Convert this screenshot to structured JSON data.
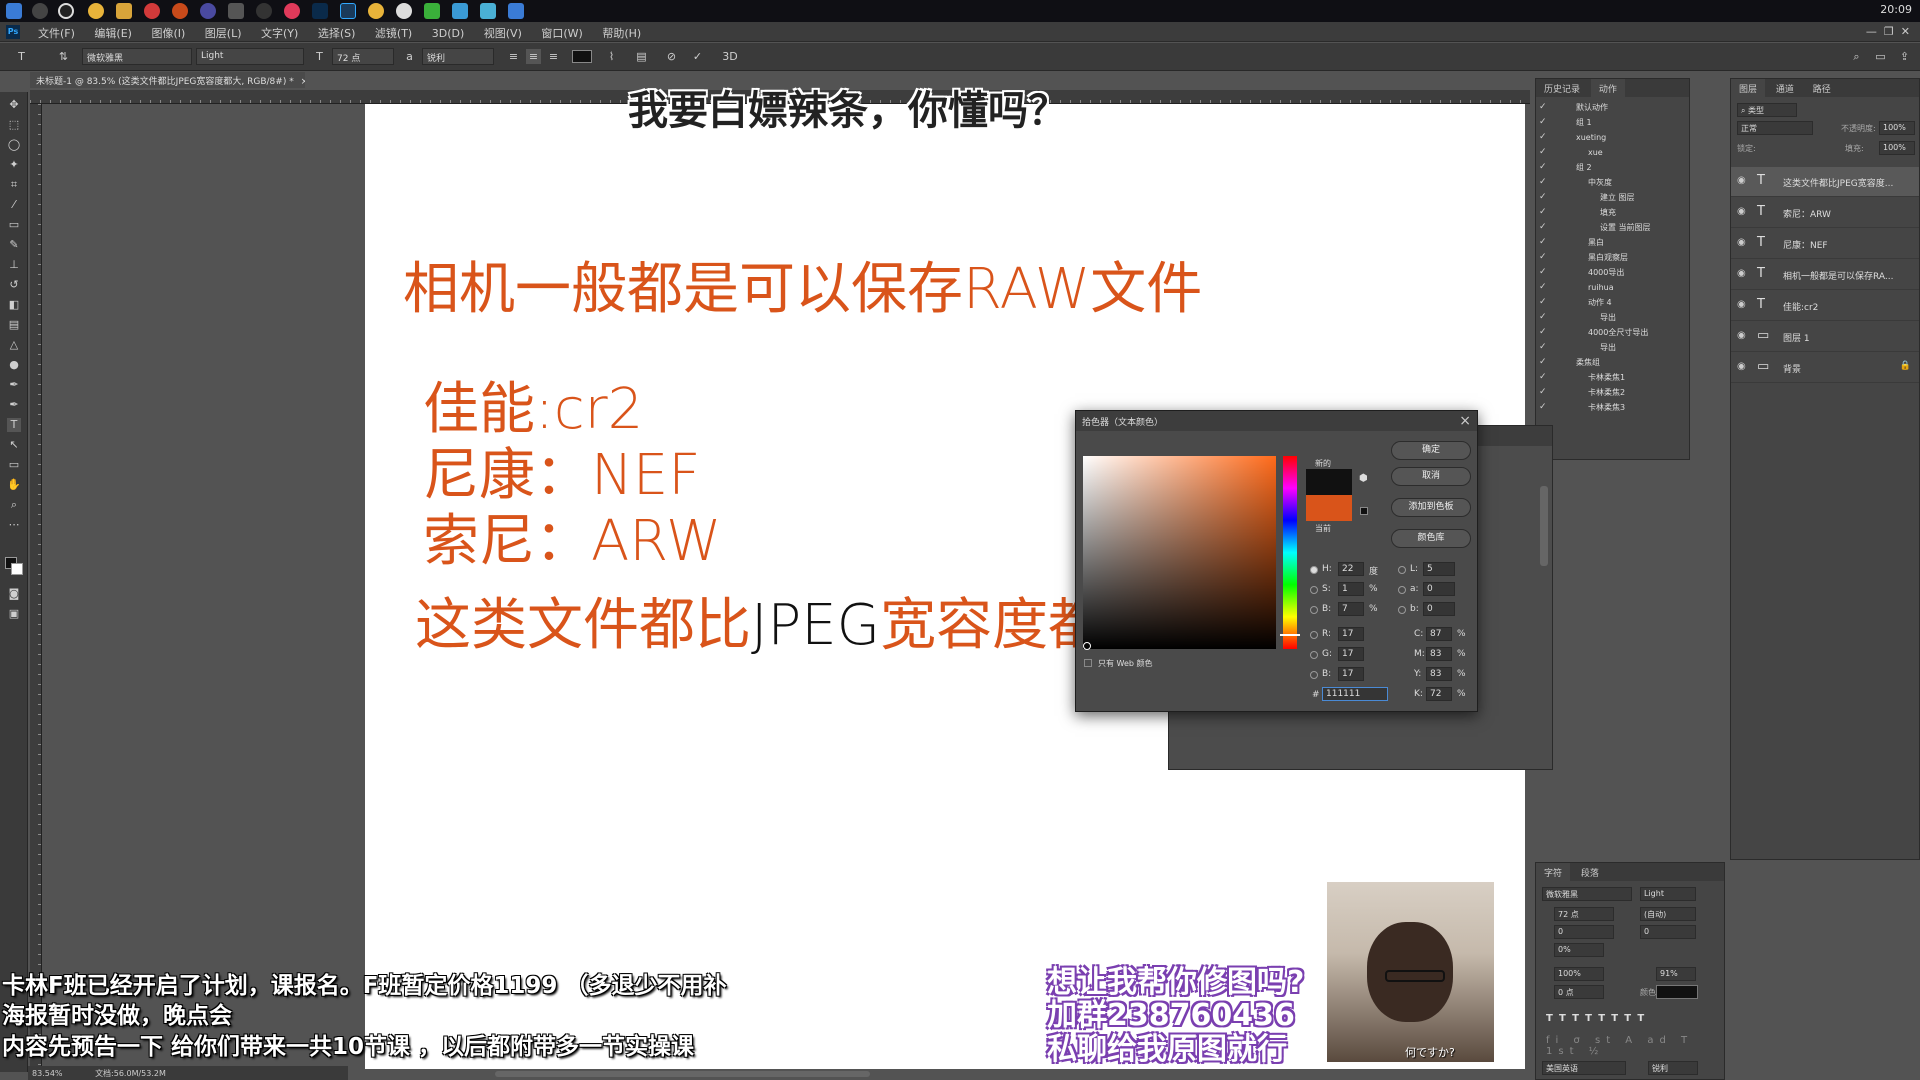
{
  "taskbar": {
    "clock": "20:09"
  },
  "menubar": {
    "items": [
      "文件(F)",
      "编辑(E)",
      "图像(I)",
      "图层(L)",
      "文字(Y)",
      "选择(S)",
      "滤镜(T)",
      "3D(D)",
      "视图(V)",
      "窗口(W)",
      "帮助(H)"
    ]
  },
  "options": {
    "font_family": "微软雅黑",
    "font_style": "Light",
    "font_size": "72 点",
    "antialias": "锐利",
    "threeD": "3D"
  },
  "document": {
    "tab_title": "未标题-1 @ 83.5% (这类文件都比JPEG宽容度都大, RGB/8#) *",
    "zoom": "83.54%",
    "doc_size": "文档:56.0M/53.2M"
  },
  "canvas": {
    "line1": "相机一般都是可以保存RAW文件",
    "canon": "佳能:cr2",
    "nikon": "尼康：NEF",
    "sony": "索尼：ARW",
    "line5_a": "这类文件都比",
    "line5_b": "JPEG",
    "line5_c": "宽容度都"
  },
  "color_picker": {
    "title": "拾色器（文本颜色）",
    "new_label": "新的",
    "current_label": "当前",
    "new_color": "#111111",
    "current_color": "#d9541a",
    "ok": "确定",
    "cancel": "取消",
    "add_swatch": "添加到色板",
    "color_library": "颜色库",
    "web_only": "只有 Web 颜色",
    "H": "22",
    "H_unit": "度",
    "S": "1",
    "S_unit": "%",
    "B": "7",
    "B_unit": "%",
    "R": "17",
    "G": "17",
    "Bv": "17",
    "L": "5",
    "a": "0",
    "b": "0",
    "C": "87",
    "M": "83",
    "Y": "83",
    "K": "72",
    "hex": "111111",
    "pct": "%"
  },
  "history_panel": {
    "tabs": [
      "历史记录",
      "动作"
    ],
    "rows": [
      "默认动作",
      "组 1",
      "xueting",
      "xue",
      "组 2",
      "中灰度",
      "建立 图层",
      "填充",
      "设置 当前图层",
      "黑白",
      "黑白观察层",
      "4000导出",
      "ruihua",
      "动作 4",
      "导出",
      "4000全尺寸导出",
      "导出",
      "柔焦组",
      "卡林柔焦1",
      "卡林柔焦2",
      "卡林柔焦3"
    ]
  },
  "layers_panel": {
    "tabs": [
      "图层",
      "通道",
      "路径"
    ],
    "search": "类型",
    "blend": "正常",
    "opacity_label": "不透明度:",
    "opacity": "100%",
    "lock_label": "锁定:",
    "fill_label": "填充:",
    "fill": "100%",
    "layers": [
      {
        "name": "这类文件都比JPEG宽容度..."
      },
      {
        "name": "索尼：ARW"
      },
      {
        "name": "尼康：NEF"
      },
      {
        "name": "相机一般都是可以保存RA..."
      },
      {
        "name": "佳能:cr2"
      },
      {
        "name": "图层 1"
      },
      {
        "name": "背景"
      }
    ]
  },
  "char_panel": {
    "tabs": [
      "字符",
      "段落"
    ],
    "font": "微软雅黑",
    "style": "Light",
    "size": "72 点",
    "leading": "(自动)",
    "kerning": "0",
    "tracking": "0",
    "scale_pct": "0%",
    "vscale": "100%",
    "hscale": "91%",
    "baseline": "0 点",
    "color_label": "颜色:",
    "lang": "美国英语",
    "aa": "锐利"
  },
  "overlays": {
    "top_caption": "我要白嫖辣条，你懂吗？",
    "ann1": "卡林F班已经开启了计划，课报名。F班暂定价格1199 （多退少不用补",
    "ann2": "海报暂时没做，晚点会",
    "ann3": "内容先预告一下 给你们带来一共10节课 ，以后都附带多一节实操课",
    "promo1": "想让我帮你修图吗?",
    "promo2": "加群238760436",
    "promo3": "私聊给我原图就行",
    "webcam_caption": "何ですか?"
  }
}
